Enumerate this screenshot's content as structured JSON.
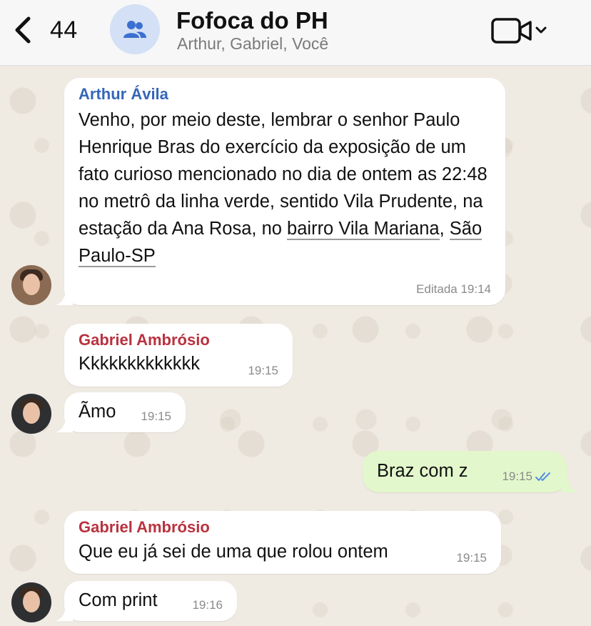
{
  "header": {
    "back_count": "44",
    "title": "Fofoca do PH",
    "subtitle": "Arthur, Gabriel, Você"
  },
  "messages": [
    {
      "sender": "Arthur Ávila",
      "text_part1": "Venho, por meio deste, lembrar o senhor Paulo Henrique Bras do exercício da exposição de um fato curioso mencionado no dia de ontem as 22:48 no metrô da linha verde, sentido Vila Prudente, na estação da Ana Rosa, no ",
      "link1": "bairro Vila Mariana",
      "text_part2": ", ",
      "link2": "São Paulo-SP",
      "meta": "Editada 19:14"
    },
    {
      "sender": "Gabriel Ambrósio",
      "text": "Kkkkkkkkkkkkk",
      "time": "19:15"
    },
    {
      "text": "Ãmo",
      "time": "19:15"
    },
    {
      "text": "Braz com z",
      "time": "19:15",
      "outgoing": true
    },
    {
      "sender": "Gabriel Ambrósio",
      "text": "Que eu já sei de uma que rolou ontem",
      "time": "19:15"
    },
    {
      "text": "Com print",
      "time": "19:16"
    }
  ],
  "colors": {
    "arthur_name": "#3566b8",
    "gabriel_name": "#b8323e",
    "outgoing_bubble": "#e2f7cb",
    "read_ticks": "#4f8fe0"
  }
}
